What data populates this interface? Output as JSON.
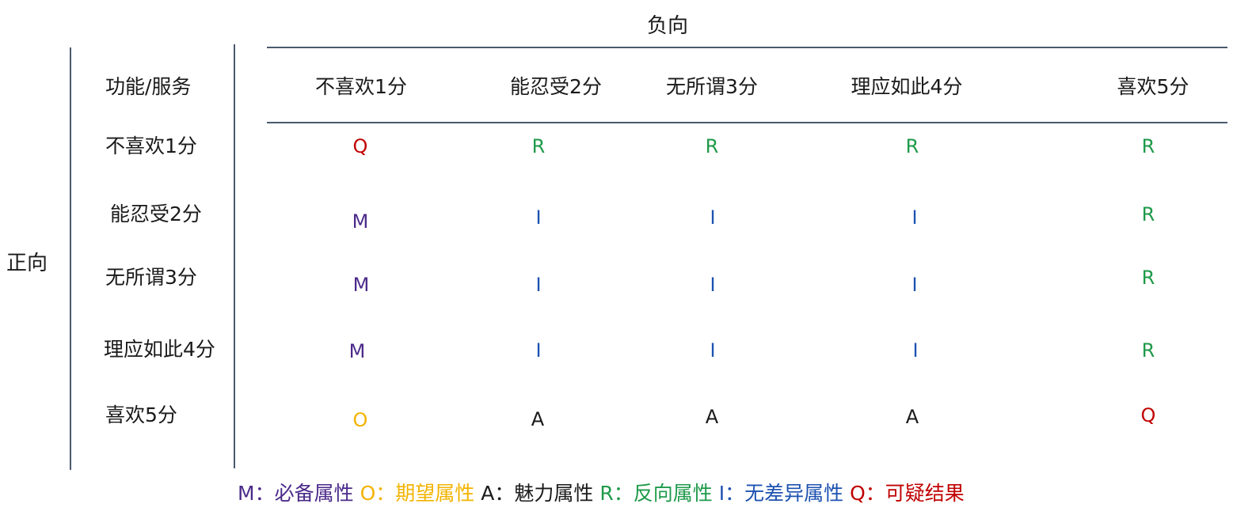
{
  "negative_axis_label": "负向",
  "positive_axis_label": "正向",
  "corner_label": "功能/服务",
  "columns": [
    "不喜欢1分",
    "能忍受2分",
    "无所谓3分",
    "理应如此4分",
    "喜欢5分"
  ],
  "rows": [
    {
      "label": "不喜欢1分",
      "cells": [
        "Q",
        "R",
        "R",
        "R",
        "R"
      ]
    },
    {
      "label": "能忍受2分",
      "cells": [
        "M",
        "I",
        "I",
        "I",
        "R"
      ]
    },
    {
      "label": "无所谓3分",
      "cells": [
        "M",
        "I",
        "I",
        "I",
        "R"
      ]
    },
    {
      "label": "理应如此4分",
      "cells": [
        "M",
        "I",
        "I",
        "I",
        "R"
      ]
    },
    {
      "label": "喜欢5分",
      "cells": [
        "O",
        "A",
        "A",
        "A",
        "Q"
      ]
    }
  ],
  "legend": [
    {
      "code": "M",
      "text": "M：必备属性",
      "color": "#4b2a8a"
    },
    {
      "code": "O",
      "text": "O：期望属性",
      "color": "#f2b300"
    },
    {
      "code": "A",
      "text": "A：魅力属性",
      "color": "#1a1a1a"
    },
    {
      "code": "R",
      "text": "R：反向属性",
      "color": "#1f9a4a"
    },
    {
      "code": "I",
      "text": "I：无差异属性",
      "color": "#1d52b0"
    },
    {
      "code": "Q",
      "text": "Q：可疑结果",
      "color": "#c00000"
    }
  ]
}
